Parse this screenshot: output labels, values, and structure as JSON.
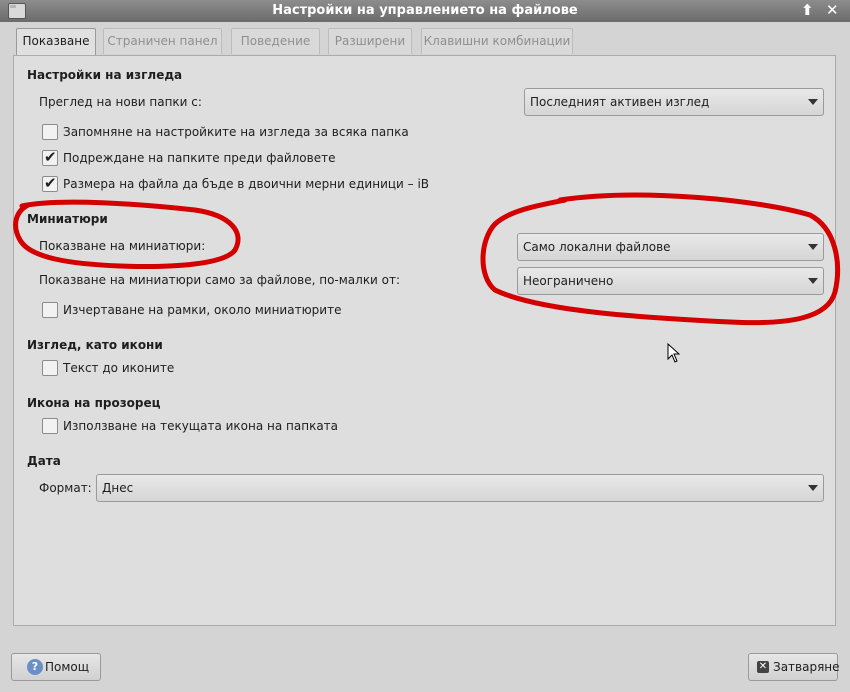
{
  "window": {
    "title": "Настройки на управлението на файлове",
    "minimize": "⬆",
    "close": "✕"
  },
  "tabs": [
    "Показване",
    "Страничен панел",
    "Поведение",
    "Разширени",
    "Клавишни комбинации"
  ],
  "view": {
    "title": "Настройки на изгледа",
    "new_folders_label": "Преглед на нови папки с:",
    "new_folders_value": "Последният активен изглед",
    "remember_label": "Запомняне на настройките на изгледа за всяка папка",
    "remember_checked": false,
    "folders_first_label": "Подреждане на папките преди файловете",
    "folders_first_checked": true,
    "binary_units_label": "Размера на файла да бъде в двоични мерни единици – iB",
    "binary_units_checked": true
  },
  "thumbnails": {
    "title": "Миниатюри",
    "show_label": "Показване на миниатюри:",
    "show_value": "Само локални файлове",
    "size_label": "Показване на миниатюри само за файлове, по-малки от:",
    "size_value": "Неограничено",
    "frames_label": "Изчертаване на рамки, около миниатюрите",
    "frames_checked": false
  },
  "icon_view": {
    "title": "Изглед, като икони",
    "text_beside_label": "Текст до иконите",
    "text_beside_checked": false
  },
  "window_icon": {
    "title": "Икона на прозорец",
    "use_folder_icon_label": "Използване на текущата икона на папката",
    "use_folder_icon_checked": false
  },
  "date": {
    "title": "Дата",
    "format_label": "Формат:",
    "format_value": "Днес"
  },
  "footer": {
    "help_label": "Помощ",
    "close_label": "Затваряне"
  },
  "annotation_color": "#d40000"
}
